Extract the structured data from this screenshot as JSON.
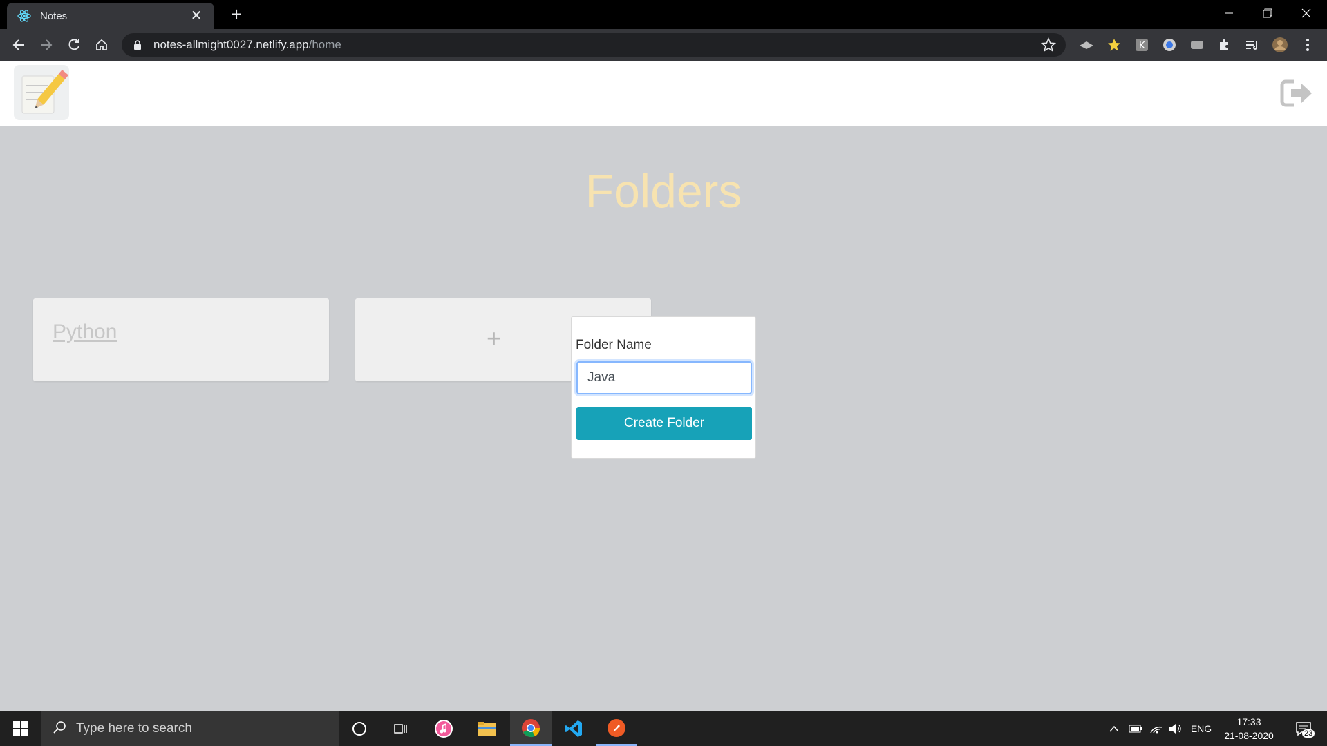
{
  "browser": {
    "tab_title": "Notes",
    "tab_close": "✕",
    "new_tab": "+",
    "url_host": "notes-allmight0027.netlify.app",
    "url_path": "/home"
  },
  "page": {
    "heading": "Folders",
    "folders": [
      {
        "name": "Python"
      }
    ],
    "add_card_symbol": "+",
    "popover": {
      "label": "Folder Name",
      "input_value": "Java",
      "button_label": "Create Folder"
    }
  },
  "taskbar": {
    "search_placeholder": "Type here to search",
    "language": "ENG",
    "time": "17:33",
    "date": "21-08-2020",
    "notification_count": "23"
  },
  "colors": {
    "heading": "#f7e3b0",
    "button": "#17a2b8",
    "page_background": "#cdcfd2"
  }
}
